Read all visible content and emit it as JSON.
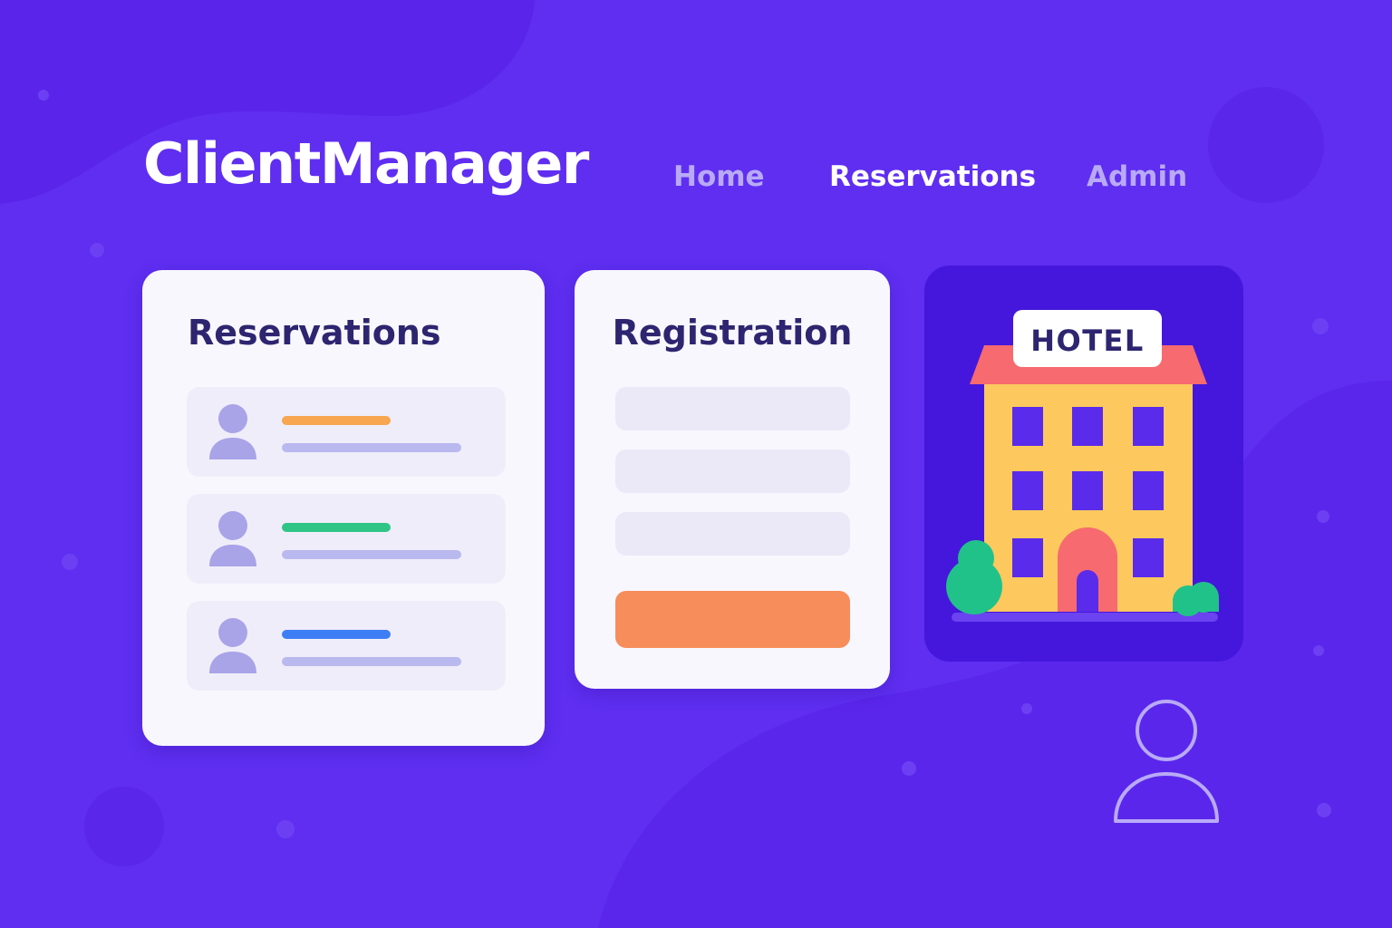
{
  "app": {
    "title": "ClientManager"
  },
  "nav": {
    "items": [
      {
        "label": "Home",
        "active": false
      },
      {
        "label": "Reservations",
        "active": true
      },
      {
        "label": "Admin",
        "active": false
      }
    ]
  },
  "reservations_card": {
    "title": "Reservations",
    "items": [
      {
        "status_color": "#f8a64f"
      },
      {
        "status_color": "#2fc586"
      },
      {
        "status_color": "#3d7ef5"
      }
    ]
  },
  "registration_card": {
    "title": "Registration",
    "fields_count": 3,
    "submit_color": "#f68d5b"
  },
  "hotel_illustration": {
    "sign_text": "HOTEL"
  },
  "icons": {
    "user": "user-icon",
    "hotel": "hotel-building-icon"
  },
  "colors": {
    "background": "#5f2ef1",
    "card": "#f8f7fd",
    "title_text": "#2d2570",
    "hotel_tile": "#4517dc"
  }
}
